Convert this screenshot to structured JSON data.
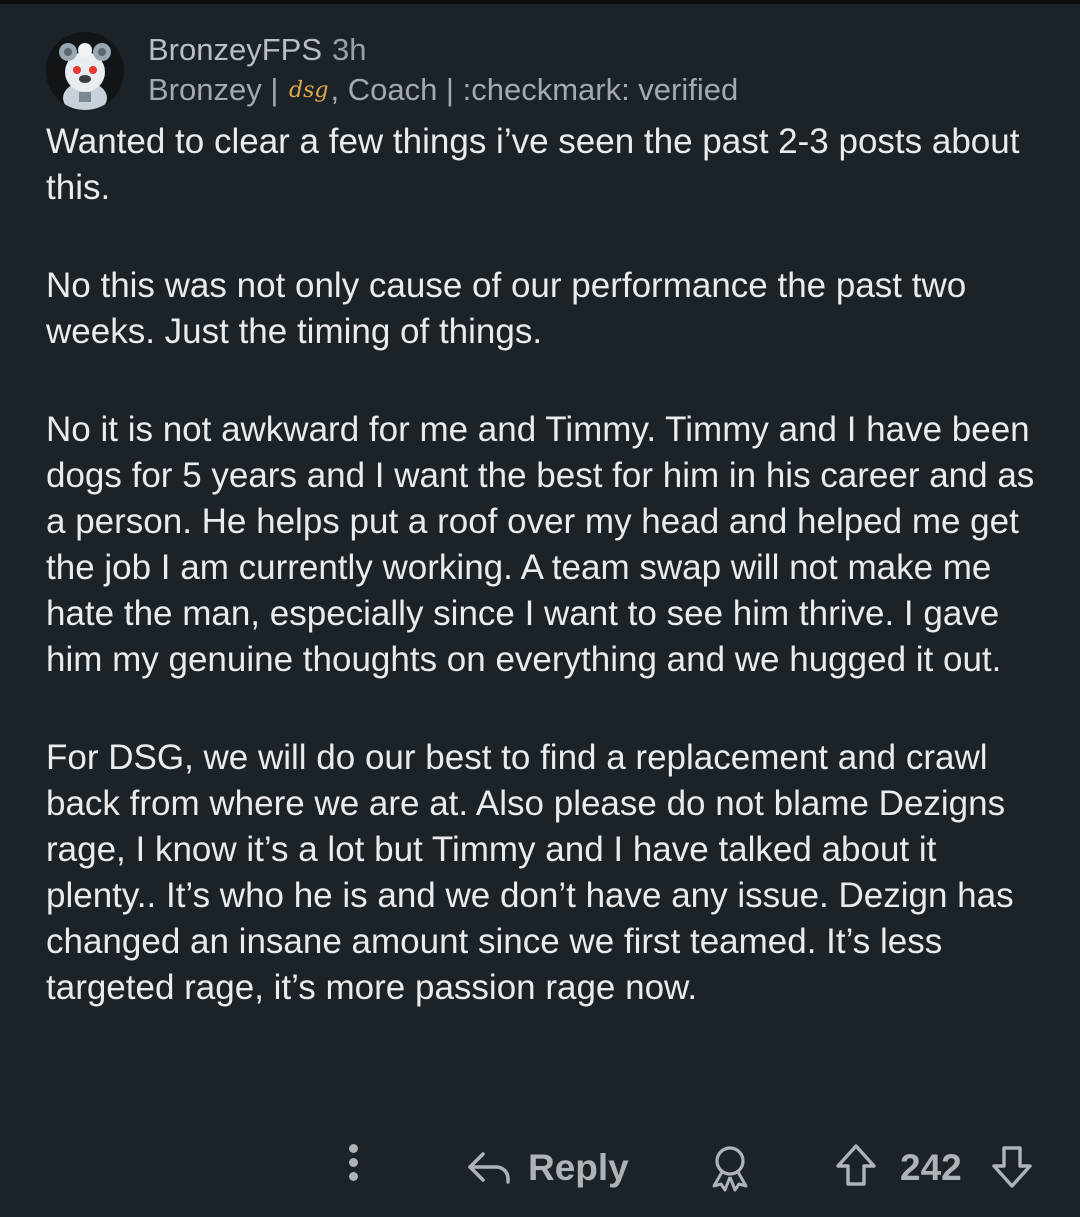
{
  "comment": {
    "username": "BronzeyFPS",
    "timestamp": "3h",
    "flair_prefix": "Bronzey | ",
    "flair_emoji": "dsg",
    "flair_suffix": ", Coach | :checkmark: verified",
    "paragraphs": [
      "Wanted to clear a few things i’ve seen the past 2-3 posts about this.",
      "No this was not only cause of our performance the past two weeks. Just the timing of things.",
      "No it is not awkward for me and Timmy. Timmy and I have been dogs for 5 years and I want the best for him in his career and as a person. He helps put a roof over my head and helped me get the job I am currently working. A team swap will not make me hate the man, especially since I want to see him thrive. I gave him my genuine thoughts on everything and we hugged it out.",
      "For DSG, we will do our best to find a replacement and crawl back from where we are at. Also please do not blame Dezigns rage, I know it’s a lot but Timmy and I have talked about it plenty.. It’s who he is and we don’t have any issue. Dezign has changed an insane amount since we first teamed. It’s less targeted rage, it’s more passion rage now."
    ]
  },
  "actions": {
    "reply_label": "Reply",
    "score": "242"
  },
  "icons": {
    "more": "more-vertical-icon",
    "reply": "reply-arrow-icon",
    "award": "award-icon",
    "upvote": "upvote-arrow-icon",
    "downvote": "downvote-arrow-icon"
  }
}
